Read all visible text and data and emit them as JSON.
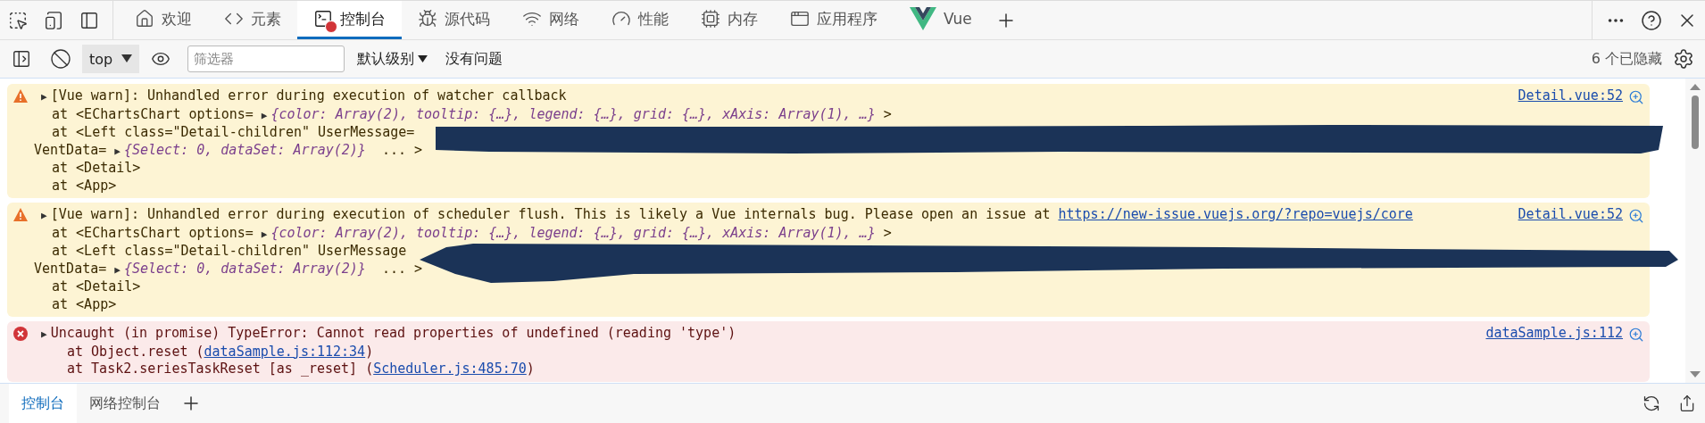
{
  "activity_bar": {
    "tabs": [
      {
        "kind": "welcome",
        "label": "欢迎",
        "selected": false,
        "error_badge": false
      },
      {
        "kind": "elements",
        "label": "元素",
        "selected": false,
        "error_badge": false
      },
      {
        "kind": "console",
        "label": "控制台",
        "selected": true,
        "error_badge": true
      },
      {
        "kind": "sources",
        "label": "源代码",
        "selected": false,
        "error_badge": false
      },
      {
        "kind": "network",
        "label": "网络",
        "selected": false,
        "error_badge": false
      },
      {
        "kind": "performance",
        "label": "性能",
        "selected": false,
        "error_badge": false
      },
      {
        "kind": "memory",
        "label": "内存",
        "selected": false,
        "error_badge": false
      },
      {
        "kind": "application",
        "label": "应用程序",
        "selected": false,
        "error_badge": false
      },
      {
        "kind": "vue",
        "label": "Vue",
        "selected": false,
        "error_badge": false
      }
    ]
  },
  "toolbar": {
    "context": "top",
    "filter_placeholder": "筛选器",
    "level": "默认级别",
    "issues": "没有问题",
    "hidden_count": "6 个已隐藏"
  },
  "messages": [
    {
      "kind": "warning",
      "redacted": true,
      "source": "Detail.vue:52",
      "lines": [
        [
          {
            "kind": "expander",
            "text": "▶"
          },
          {
            "kind": "plain",
            "text": "[Vue warn]: Unhandled error during execution of watcher callback"
          }
        ],
        [
          {
            "kind": "plain",
            "text": "at <EChartsChart options= "
          },
          {
            "kind": "expander",
            "text": "▶"
          },
          {
            "kind": "object",
            "text": "{color: Array(2), tooltip: {…}, legend: {…}, grid: {…}, xAxis: Array(1), …}"
          },
          {
            "kind": "plain",
            "text": " >"
          }
        ],
        [
          {
            "kind": "plain",
            "text": "at <Left class=\"Detail-children\" UserMessage="
          }
        ],
        [
          {
            "kind": "wrap",
            "text": "VentData= "
          },
          {
            "kind": "expander",
            "text": "▶"
          },
          {
            "kind": "object",
            "text": "{Select: 0, dataSet: Array(2)}"
          },
          {
            "kind": "plain",
            "text": "  ... >"
          }
        ],
        [
          {
            "kind": "plain",
            "text": "at <Detail>"
          }
        ],
        [
          {
            "kind": "plain",
            "text": "at <App>"
          }
        ]
      ]
    },
    {
      "kind": "warning",
      "redacted": true,
      "source": "Detail.vue:52",
      "lines": [
        [
          {
            "kind": "expander",
            "text": "▶"
          },
          {
            "kind": "plain",
            "text": "[Vue warn]: Unhandled error during execution of scheduler flush. This is likely a Vue internals bug. Please open an issue at "
          },
          {
            "kind": "link",
            "text": "https://new-issue.vuejs.org/?repo=vuejs/core"
          }
        ],
        [
          {
            "kind": "plain",
            "text": "at <EChartsChart options= "
          },
          {
            "kind": "expander",
            "text": "▶"
          },
          {
            "kind": "object",
            "text": "{color: Array(2), tooltip: {…}, legend: {…}, grid: {…}, xAxis: Array(1), …}"
          },
          {
            "kind": "plain",
            "text": " >"
          }
        ],
        [
          {
            "kind": "plain",
            "text": "at <Left class=\"Detail-children\" UserMessage"
          }
        ],
        [
          {
            "kind": "wrap",
            "text": "VentData= "
          },
          {
            "kind": "expander",
            "text": "▶"
          },
          {
            "kind": "object",
            "text": "{Select: 0, dataSet: Array(2)}"
          },
          {
            "kind": "plain",
            "text": "  ... >"
          }
        ],
        [
          {
            "kind": "plain",
            "text": "at <Detail>"
          }
        ],
        [
          {
            "kind": "plain",
            "text": "at <App>"
          }
        ]
      ]
    },
    {
      "kind": "error",
      "redacted": false,
      "source": "dataSample.js:112",
      "lines": [
        [
          {
            "kind": "expander",
            "text": "▶"
          },
          {
            "kind": "plain",
            "text": "Uncaught (in promise) TypeError: Cannot read properties of undefined (reading 'type')"
          }
        ],
        [
          {
            "kind": "deep",
            "text": "at Object.reset ("
          },
          {
            "kind": "link",
            "text": "dataSample.js:112:34"
          },
          {
            "kind": "plain",
            "text": ")"
          }
        ],
        [
          {
            "kind": "deep",
            "text": "at Task2.seriesTaskReset [as _reset] ("
          },
          {
            "kind": "link",
            "text": "Scheduler.js:485:70"
          },
          {
            "kind": "plain",
            "text": ")"
          }
        ]
      ]
    }
  ],
  "drawer": {
    "tabs": [
      {
        "label": "控制台",
        "selected": true
      },
      {
        "label": "网络控制台",
        "selected": false
      }
    ]
  }
}
